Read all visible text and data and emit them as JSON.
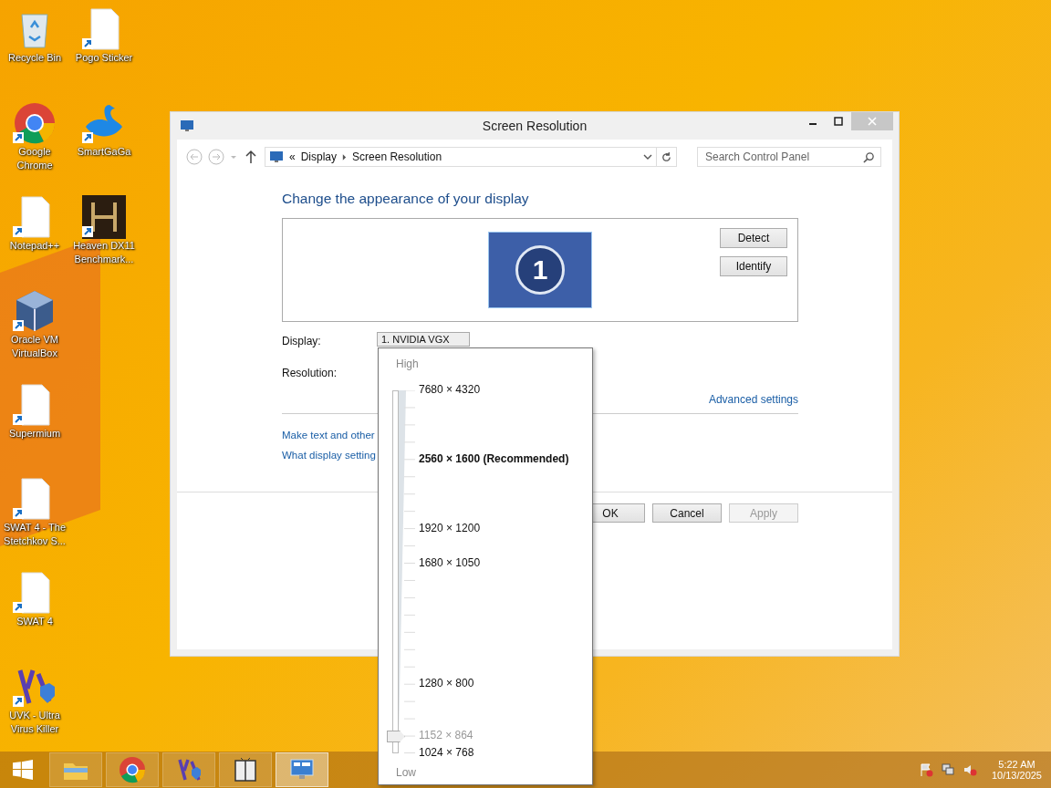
{
  "desktop_icons": [
    {
      "label": "Recycle Bin",
      "kind": "bin"
    },
    {
      "label": "Google Chrome",
      "kind": "chrome"
    },
    {
      "label": "Notepad++",
      "kind": "doc"
    },
    {
      "label": "Oracle VM VirtualBox",
      "kind": "cube"
    },
    {
      "label": "Supermium",
      "kind": "doc"
    },
    {
      "label": "SWAT 4 - The Stetchkov S...",
      "kind": "doc"
    },
    {
      "label": "SWAT 4",
      "kind": "doc"
    },
    {
      "label": "UVK - Ultra Virus Killer",
      "kind": "uvk"
    },
    {
      "label": "Pogo Sticker",
      "kind": "doc"
    },
    {
      "label": "SmartGaGa",
      "kind": "swan"
    },
    {
      "label": "Heaven DX11 Benchmark...",
      "kind": "game"
    }
  ],
  "window": {
    "title": "Screen Resolution",
    "address_prefix": "«",
    "breadcrumb": [
      "Display",
      "Screen Resolution"
    ],
    "search": {
      "placeholder": "Search Control Panel"
    },
    "heading": "Change the appearance of your display",
    "monitor_number": "1",
    "side_buttons": [
      "Detect",
      "Identify"
    ],
    "display_label": "Display:",
    "display_value": "1. NVIDIA VGX",
    "resolution_label": "Resolution:",
    "advanced_link": "Advanced settings",
    "links": [
      "Make text and other",
      "What display setting"
    ],
    "buttons": [
      {
        "label": "OK",
        "disabled": false
      },
      {
        "label": "Cancel",
        "disabled": false
      },
      {
        "label": "Apply",
        "disabled": true
      }
    ]
  },
  "resolution_popup": {
    "high": "High",
    "low": "Low",
    "level": 0.05,
    "stops": [
      {
        "label": "7680 × 4320",
        "recommended": false,
        "selected": false
      },
      {
        "label": "2560 × 1600 (Recommended)",
        "recommended": true,
        "selected": false
      },
      {
        "label": "1920 × 1200",
        "recommended": false,
        "selected": false
      },
      {
        "label": "1680 × 1050",
        "recommended": false,
        "selected": false
      },
      {
        "label": "1280 × 800",
        "recommended": false,
        "selected": false
      },
      {
        "label": "1152 × 864",
        "recommended": false,
        "selected": true
      },
      {
        "label": "1024 × 768",
        "recommended": false,
        "selected": false
      }
    ]
  },
  "taskbar": {
    "apps": [
      {
        "kind": "folder",
        "selected": false
      },
      {
        "kind": "chrome",
        "selected": false
      },
      {
        "kind": "uvk",
        "selected": false
      },
      {
        "kind": "panel",
        "selected": false
      },
      {
        "kind": "display",
        "selected": true
      }
    ],
    "time": "5:22 AM",
    "date": "10/13/2025"
  }
}
